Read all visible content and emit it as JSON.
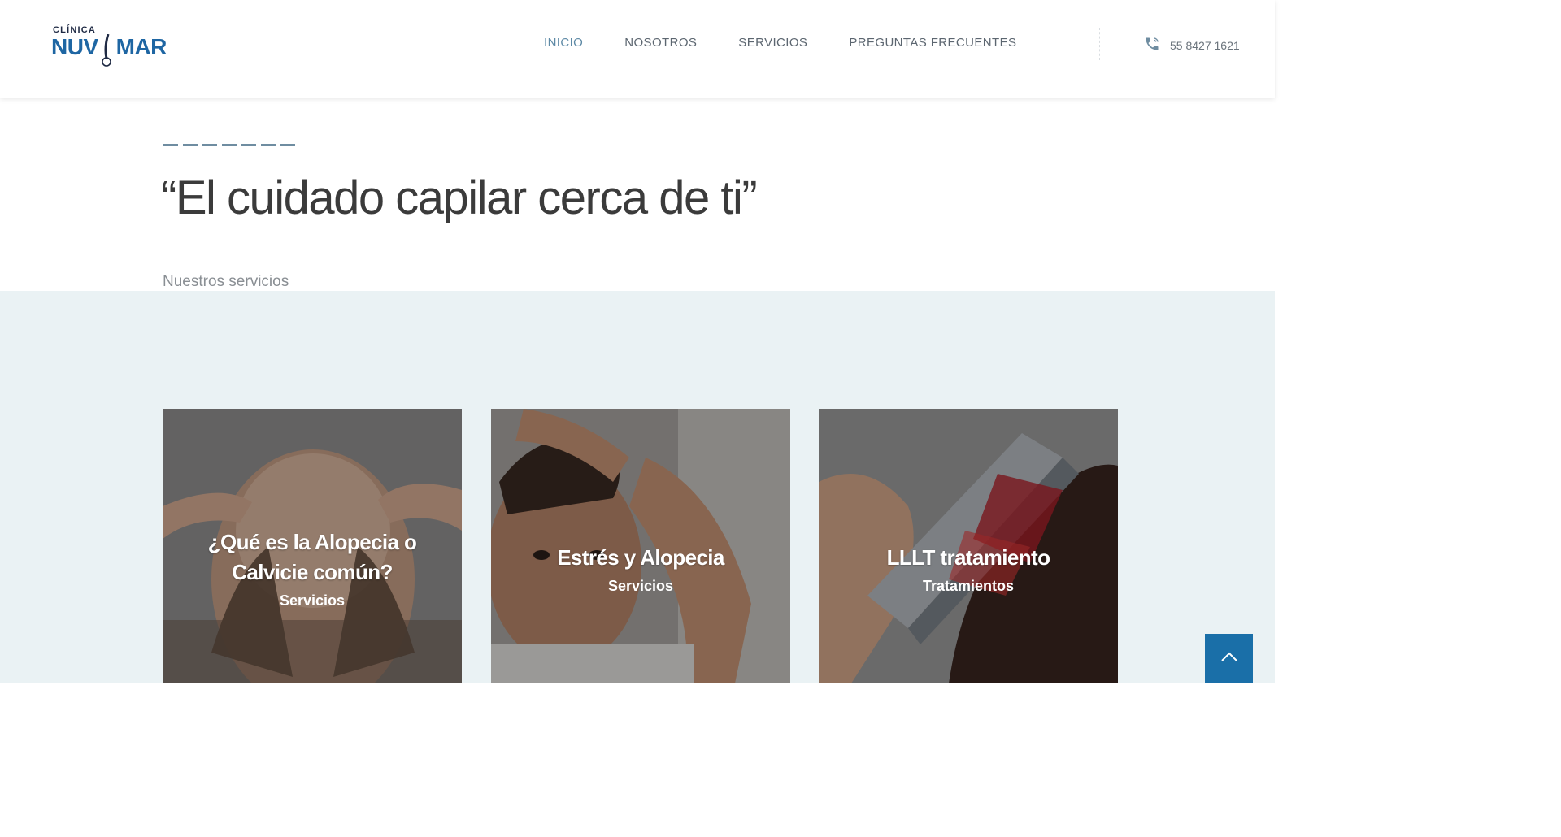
{
  "header": {
    "logo": {
      "top_text": "CLÍNICA",
      "left_text": "NUV",
      "right_text": "MAR"
    },
    "nav": [
      {
        "label": "INICIO",
        "active": true
      },
      {
        "label": "NOSOTROS",
        "active": false
      },
      {
        "label": "SERVICIOS",
        "active": false
      },
      {
        "label": "PREGUNTAS FRECUENTES",
        "active": false
      }
    ],
    "phone": {
      "icon": "phone-icon",
      "number": "55 8427 1621"
    }
  },
  "hero": {
    "title": "“El cuidado capilar cerca de ti”",
    "section_label": "Nuestros servicios"
  },
  "services": [
    {
      "title_line1": "¿Qué es la Alopecia o",
      "title_line2": "Calvicie común?",
      "category": "Servicios"
    },
    {
      "title_line1": "Estrés y Alopecia",
      "title_line2": "",
      "category": "Servicios"
    },
    {
      "title_line1": "LLLT tratamiento",
      "title_line2": "",
      "category": "Tratamientos"
    }
  ],
  "scroll_top": {
    "icon": "chevron-up-icon"
  },
  "colors": {
    "brand_blue": "#1e66a3",
    "nav_active": "#5e8aa6",
    "band_bg": "#eaf2f4",
    "scroll_button": "#1a6fa8"
  }
}
